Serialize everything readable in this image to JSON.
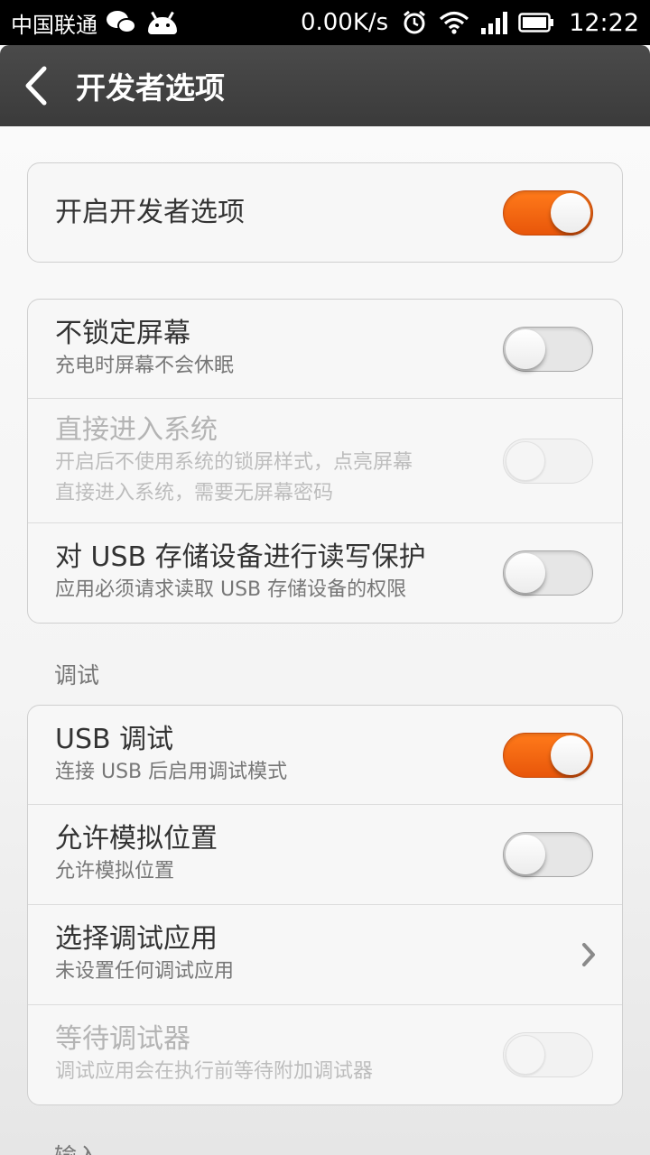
{
  "status_bar": {
    "carrier": "中国联通",
    "net_speed": "0.00K/s",
    "time": "12:22",
    "icons": [
      "wechat-icon",
      "android-icon",
      "alarm-icon",
      "wifi-icon",
      "signal-icon",
      "battery-icon"
    ]
  },
  "header": {
    "title": "开发者选项"
  },
  "master": {
    "title": "开启开发者选项",
    "on": true
  },
  "general": {
    "items": [
      {
        "title": "不锁定屏幕",
        "subtitle": "充电时屏幕不会休眠",
        "on": false,
        "enabled": true
      },
      {
        "title": "直接进入系统",
        "subtitle_line1": "开启后不使用系统的锁屏样式，点亮屏幕",
        "subtitle_line2": "直接进入系统，需要无屏幕密码",
        "on": false,
        "enabled": false
      },
      {
        "title": "对 USB 存储设备进行读写保护",
        "subtitle": "应用必须请求读取 USB 存储设备的权限",
        "on": false,
        "enabled": true
      }
    ]
  },
  "debug_section": {
    "label": "调试",
    "items": [
      {
        "title": "USB 调试",
        "subtitle": "连接 USB 后启用调试模式",
        "on": true,
        "enabled": true
      },
      {
        "title": "允许模拟位置",
        "subtitle": "允许模拟位置",
        "on": false,
        "enabled": true
      },
      {
        "title": "选择调试应用",
        "subtitle": "未设置任何调试应用",
        "control": "chevron"
      },
      {
        "title": "等待调试器",
        "subtitle": "调试应用会在执行前等待附加调试器",
        "on": false,
        "enabled": false
      }
    ]
  },
  "input_section": {
    "label": "输入"
  },
  "colors": {
    "accent": "#f26a10",
    "titlebar": "#3f3f3f",
    "statusbar": "#000000"
  }
}
